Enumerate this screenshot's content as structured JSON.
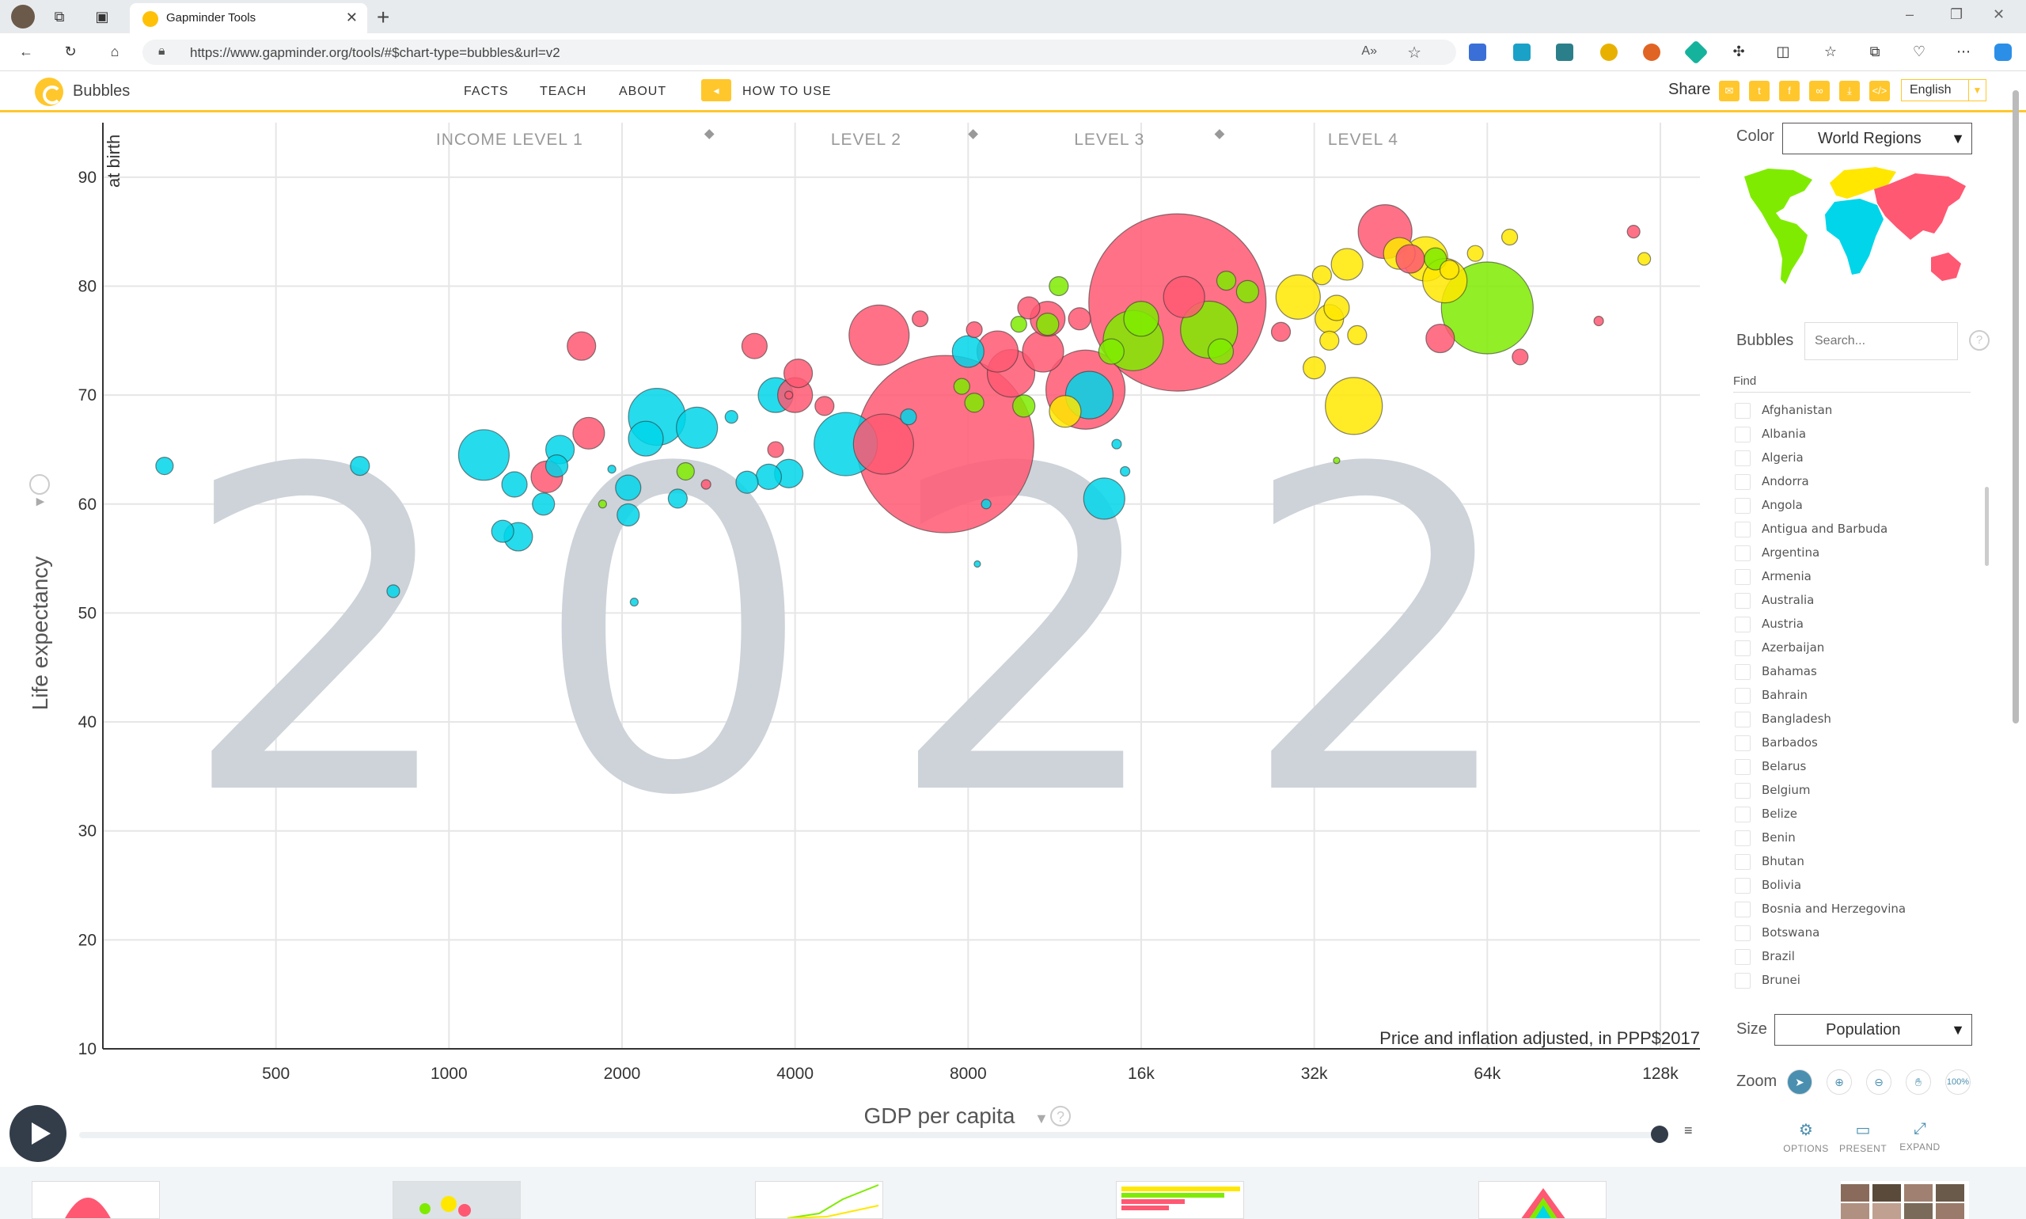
{
  "browser": {
    "tab_title": "Gapminder Tools",
    "url": "https://www.gapminder.org/tools/#$chart-type=bubbles&url=v2"
  },
  "app": {
    "name": "Bubbles",
    "nav": [
      "FACTS",
      "TEACH",
      "ABOUT"
    ],
    "how_to_use": "HOW TO USE",
    "share_label": "Share",
    "language": "English"
  },
  "panel": {
    "color_label": "Color",
    "color_value": "World Regions",
    "bubbles_label": "Bubbles",
    "search_placeholder": "Search...",
    "find_label": "Find",
    "countries": [
      "Afghanistan",
      "Albania",
      "Algeria",
      "Andorra",
      "Angola",
      "Antigua and Barbuda",
      "Argentina",
      "Armenia",
      "Australia",
      "Austria",
      "Azerbaijan",
      "Bahamas",
      "Bahrain",
      "Bangladesh",
      "Barbados",
      "Belarus",
      "Belgium",
      "Belize",
      "Benin",
      "Bhutan",
      "Bolivia",
      "Bosnia and Herzegovina",
      "Botswana",
      "Brazil",
      "Brunei"
    ],
    "size_label": "Size",
    "size_value": "Population",
    "zoom_label": "Zoom",
    "zoom_100": "100%",
    "options": [
      "OPTIONS",
      "PRESENT",
      "EXPAND"
    ]
  },
  "colors": {
    "africa": "#00d5e9",
    "americas": "#7feb00",
    "asia": "#ff5872",
    "europe": "#ffe700",
    "brand": "#ffc72c"
  },
  "chart_data": {
    "type": "scatter",
    "year": "2022",
    "xlabel": "GDP per capita",
    "ylabel": "Life expectancy",
    "ylabel_extra": "at birth",
    "x_scale": "log2",
    "xlim": [
      250,
      150000
    ],
    "ylim": [
      10,
      95
    ],
    "x_ticks": [
      500,
      1000,
      2000,
      4000,
      8000,
      16000,
      32000,
      64000,
      128000
    ],
    "x_tick_labels": [
      "500",
      "1000",
      "2000",
      "4000",
      "8000",
      "16k",
      "32k",
      "64k",
      "128k"
    ],
    "y_ticks": [
      10,
      20,
      30,
      40,
      50,
      60,
      70,
      80,
      90
    ],
    "income_levels": [
      "INCOME LEVEL 1",
      "LEVEL 2",
      "LEVEL 3",
      "LEVEL 4"
    ],
    "income_boundaries": [
      2850,
      8200,
      22000
    ],
    "note": "Price and inflation adjusted, in PPP$2017",
    "grid": true,
    "bubbles": [
      {
        "x": 7300,
        "y": 65.5,
        "r": 112,
        "c": "asia"
      },
      {
        "x": 18500,
        "y": 78.5,
        "r": 112,
        "c": "asia"
      },
      {
        "x": 5700,
        "y": 65.5,
        "r": 38,
        "c": "asia"
      },
      {
        "x": 4900,
        "y": 65.5,
        "r": 40,
        "c": "africa"
      },
      {
        "x": 5600,
        "y": 75.5,
        "r": 38,
        "c": "asia"
      },
      {
        "x": 15500,
        "y": 75,
        "r": 38,
        "c": "americas"
      },
      {
        "x": 21000,
        "y": 76,
        "r": 36,
        "c": "americas"
      },
      {
        "x": 12800,
        "y": 70.5,
        "r": 50,
        "c": "asia"
      },
      {
        "x": 13000,
        "y": 70,
        "r": 30,
        "c": "africa"
      },
      {
        "x": 9500,
        "y": 72,
        "r": 30,
        "c": "asia"
      },
      {
        "x": 9000,
        "y": 74,
        "r": 26,
        "c": "asia"
      },
      {
        "x": 11000,
        "y": 77,
        "r": 22,
        "c": "asia"
      },
      {
        "x": 10800,
        "y": 74,
        "r": 26,
        "c": "asia"
      },
      {
        "x": 64000,
        "y": 78,
        "r": 58,
        "c": "americas"
      },
      {
        "x": 37500,
        "y": 69,
        "r": 36,
        "c": "europe"
      },
      {
        "x": 42500,
        "y": 85,
        "r": 34,
        "c": "asia"
      },
      {
        "x": 50000,
        "y": 82.5,
        "r": 28,
        "c": "europe"
      },
      {
        "x": 54000,
        "y": 80.5,
        "r": 28,
        "c": "europe"
      },
      {
        "x": 30000,
        "y": 79,
        "r": 28,
        "c": "europe"
      },
      {
        "x": 36500,
        "y": 82,
        "r": 20,
        "c": "europe"
      },
      {
        "x": 45000,
        "y": 83,
        "r": 20,
        "c": "europe"
      },
      {
        "x": 47000,
        "y": 82.5,
        "r": 18,
        "c": "asia"
      },
      {
        "x": 52000,
        "y": 82.5,
        "r": 14,
        "c": "americas"
      },
      {
        "x": 34000,
        "y": 77,
        "r": 18,
        "c": "europe"
      },
      {
        "x": 19000,
        "y": 79,
        "r": 26,
        "c": "asia"
      },
      {
        "x": 2300,
        "y": 68,
        "r": 36,
        "c": "africa"
      },
      {
        "x": 2700,
        "y": 67,
        "r": 26,
        "c": "africa"
      },
      {
        "x": 2200,
        "y": 66,
        "r": 22,
        "c": "africa"
      },
      {
        "x": 1150,
        "y": 64.5,
        "r": 32,
        "c": "africa"
      },
      {
        "x": 3700,
        "y": 70,
        "r": 22,
        "c": "africa"
      },
      {
        "x": 3600,
        "y": 62.5,
        "r": 16,
        "c": "africa"
      },
      {
        "x": 13800,
        "y": 60.5,
        "r": 26,
        "c": "africa"
      },
      {
        "x": 8000,
        "y": 74,
        "r": 20,
        "c": "africa"
      },
      {
        "x": 1700,
        "y": 74.5,
        "r": 18,
        "c": "asia"
      },
      {
        "x": 3400,
        "y": 74.5,
        "r": 16,
        "c": "asia"
      },
      {
        "x": 1750,
        "y": 66.5,
        "r": 20,
        "c": "asia"
      },
      {
        "x": 4050,
        "y": 72,
        "r": 18,
        "c": "asia"
      },
      {
        "x": 4000,
        "y": 70,
        "r": 22,
        "c": "asia"
      },
      {
        "x": 1480,
        "y": 62.5,
        "r": 20,
        "c": "asia"
      },
      {
        "x": 1320,
        "y": 57,
        "r": 18,
        "c": "africa"
      },
      {
        "x": 1240,
        "y": 57.5,
        "r": 14,
        "c": "africa"
      },
      {
        "x": 1300,
        "y": 61.8,
        "r": 16,
        "c": "africa"
      },
      {
        "x": 1460,
        "y": 60,
        "r": 14,
        "c": "africa"
      },
      {
        "x": 1560,
        "y": 65,
        "r": 18,
        "c": "africa"
      },
      {
        "x": 1540,
        "y": 63.5,
        "r": 14,
        "c": "africa"
      },
      {
        "x": 2050,
        "y": 61.5,
        "r": 16,
        "c": "africa"
      },
      {
        "x": 2050,
        "y": 59,
        "r": 14,
        "c": "africa"
      },
      {
        "x": 2500,
        "y": 60.5,
        "r": 12,
        "c": "africa"
      },
      {
        "x": 3300,
        "y": 62,
        "r": 14,
        "c": "africa"
      },
      {
        "x": 3900,
        "y": 62.8,
        "r": 18,
        "c": "africa"
      },
      {
        "x": 320,
        "y": 63.5,
        "r": 11,
        "c": "africa"
      },
      {
        "x": 700,
        "y": 63.5,
        "r": 12,
        "c": "africa"
      },
      {
        "x": 800,
        "y": 52,
        "r": 8,
        "c": "africa"
      },
      {
        "x": 2580,
        "y": 63,
        "r": 11,
        "c": "americas"
      },
      {
        "x": 10000,
        "y": 69,
        "r": 14,
        "c": "americas"
      },
      {
        "x": 11500,
        "y": 80,
        "r": 12,
        "c": "americas"
      },
      {
        "x": 11000,
        "y": 76.5,
        "r": 14,
        "c": "americas"
      },
      {
        "x": 14200,
        "y": 74,
        "r": 16,
        "c": "americas"
      },
      {
        "x": 16000,
        "y": 77,
        "r": 22,
        "c": "americas"
      },
      {
        "x": 22500,
        "y": 80.5,
        "r": 12,
        "c": "americas"
      },
      {
        "x": 24500,
        "y": 79.5,
        "r": 14,
        "c": "americas"
      },
      {
        "x": 22000,
        "y": 74,
        "r": 16,
        "c": "americas"
      },
      {
        "x": 8200,
        "y": 69.3,
        "r": 12,
        "c": "americas"
      },
      {
        "x": 9800,
        "y": 76.5,
        "r": 10,
        "c": "americas"
      },
      {
        "x": 11800,
        "y": 68.5,
        "r": 20,
        "c": "europe"
      },
      {
        "x": 32000,
        "y": 72.5,
        "r": 14,
        "c": "europe"
      },
      {
        "x": 33000,
        "y": 81,
        "r": 12,
        "c": "europe"
      },
      {
        "x": 34000,
        "y": 75,
        "r": 12,
        "c": "europe"
      },
      {
        "x": 35000,
        "y": 78,
        "r": 16,
        "c": "europe"
      },
      {
        "x": 38000,
        "y": 75.5,
        "r": 12,
        "c": "europe"
      },
      {
        "x": 55000,
        "y": 81.5,
        "r": 12,
        "c": "europe"
      },
      {
        "x": 61000,
        "y": 83,
        "r": 10,
        "c": "europe"
      },
      {
        "x": 70000,
        "y": 84.5,
        "r": 10,
        "c": "europe"
      },
      {
        "x": 120000,
        "y": 82.5,
        "r": 8,
        "c": "europe"
      },
      {
        "x": 28000,
        "y": 75.8,
        "r": 12,
        "c": "asia"
      },
      {
        "x": 53000,
        "y": 75.2,
        "r": 18,
        "c": "asia"
      },
      {
        "x": 73000,
        "y": 73.5,
        "r": 10,
        "c": "asia"
      },
      {
        "x": 100000,
        "y": 76.8,
        "r": 6,
        "c": "asia"
      },
      {
        "x": 115000,
        "y": 85,
        "r": 8,
        "c": "asia"
      },
      {
        "x": 4500,
        "y": 69,
        "r": 12,
        "c": "asia"
      },
      {
        "x": 3700,
        "y": 65,
        "r": 10,
        "c": "asia"
      },
      {
        "x": 3100,
        "y": 68,
        "r": 8,
        "c": "africa"
      },
      {
        "x": 6600,
        "y": 77,
        "r": 10,
        "c": "asia"
      },
      {
        "x": 8200,
        "y": 76,
        "r": 10,
        "c": "asia"
      },
      {
        "x": 6300,
        "y": 68,
        "r": 10,
        "c": "africa"
      },
      {
        "x": 7800,
        "y": 70.8,
        "r": 10,
        "c": "americas"
      },
      {
        "x": 10200,
        "y": 78,
        "r": 14,
        "c": "asia"
      },
      {
        "x": 12500,
        "y": 77,
        "r": 14,
        "c": "asia"
      },
      {
        "x": 14500,
        "y": 65.5,
        "r": 6,
        "c": "africa"
      },
      {
        "x": 15000,
        "y": 63,
        "r": 6,
        "c": "africa"
      },
      {
        "x": 8600,
        "y": 60,
        "r": 6,
        "c": "africa"
      },
      {
        "x": 8300,
        "y": 54.5,
        "r": 4,
        "c": "africa"
      },
      {
        "x": 2100,
        "y": 51,
        "r": 5,
        "c": "africa"
      },
      {
        "x": 1920,
        "y": 63.2,
        "r": 5,
        "c": "africa"
      },
      {
        "x": 1850,
        "y": 60,
        "r": 5,
        "c": "americas"
      },
      {
        "x": 35000,
        "y": 64,
        "r": 4,
        "c": "americas"
      },
      {
        "x": 3900,
        "y": 70,
        "r": 5,
        "c": "asia"
      },
      {
        "x": 2800,
        "y": 61.8,
        "r": 6,
        "c": "asia"
      }
    ]
  }
}
